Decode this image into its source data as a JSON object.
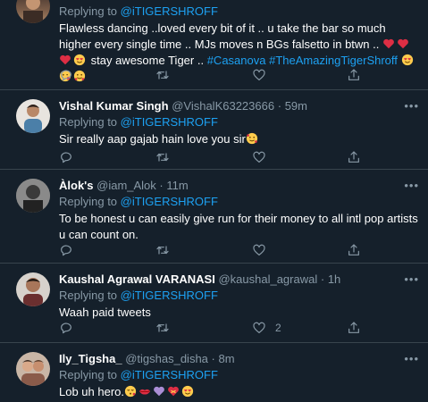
{
  "tweets": [
    {
      "name": "",
      "handle": "",
      "time": "",
      "replying_label": "Replying to",
      "replying_to": "@iTIGERSHROFF",
      "body_text": "Flawless dancing ..loved every bit of it .. u take the bar so much higher every single time .. MJs moves n BGs falsetto in btwn ..",
      "body_suffix": "stay awesome Tiger ..",
      "hashtags": [
        "#Casanova",
        "#TheAmazingTigerShroff"
      ],
      "like_count": ""
    },
    {
      "name": "Vishal Kumar Singh",
      "handle": "@VishalK63223666",
      "time": "59m",
      "replying_label": "Replying to",
      "replying_to": "@iTIGERSHROFF",
      "body_text": "Sir really aap gajab hain love you sir",
      "like_count": ""
    },
    {
      "name": "Àlok's",
      "handle": "@iam_Alok",
      "time": "11m",
      "replying_label": "Replying to",
      "replying_to": "@iTIGERSHROFF",
      "body_text": "To be honest u can easily give run for their money to all intl pop artists u can count on.",
      "like_count": ""
    },
    {
      "name": "Kaushal Agrawal VARANASI",
      "handle": "@kaushal_agrawal",
      "time": "1h",
      "replying_label": "Replying to",
      "replying_to": "@iTIGERSHROFF",
      "body_text": "Waah paid tweets",
      "like_count": "2"
    },
    {
      "name": "Ily_Tigsha_",
      "handle": "@tigshas_disha",
      "time": "8m",
      "replying_label": "Replying to",
      "replying_to": "@iTIGERSHROFF",
      "body_text": "Lob uh hero.",
      "like_count": ""
    }
  ],
  "ui": {
    "separator": "·",
    "more_label": "•••"
  },
  "icons": {
    "reply": "reply-icon",
    "retweet": "retweet-icon",
    "like": "heart-icon",
    "share": "share-icon",
    "more": "more-icon"
  },
  "colors": {
    "background": "#15202b",
    "divider": "#38444d",
    "secondary_text": "#8899a6",
    "accent": "#1da1f2"
  }
}
